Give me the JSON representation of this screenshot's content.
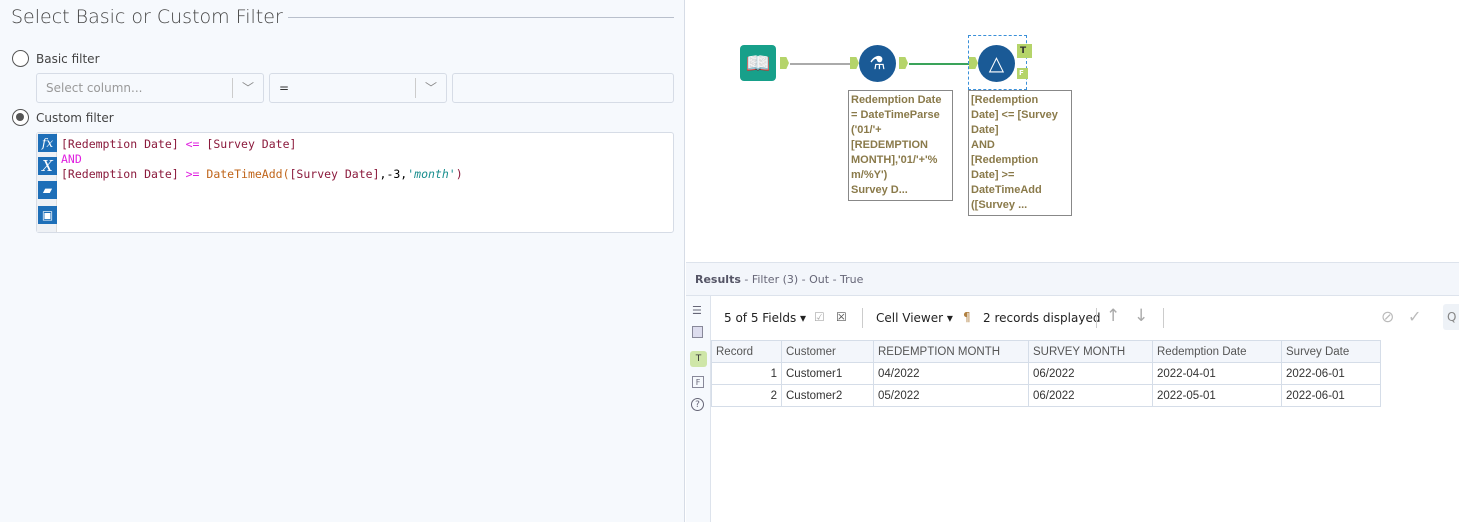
{
  "config": {
    "title": "Select Basic or Custom Filter",
    "basic_label": "Basic filter",
    "select_column_placeholder": "Select column...",
    "operator": "=",
    "custom_label": "Custom filter",
    "code": {
      "l1a": "[Redemption Date]",
      "l1b": " <= ",
      "l1c": "[Survey Date]",
      "l2": "AND",
      "l3a": "[Redemption Date]",
      "l3b": " >= ",
      "l3c": "DateTimeAdd(",
      "l3d": "[Survey Date]",
      "l3e": ",-3,",
      "l3f": "'month'",
      "l3g": ")"
    }
  },
  "workflow": {
    "formula_note": [
      "Redemption Date",
      "= DateTimeParse",
      "('01/'+",
      "[REDEMPTION",
      "MONTH],'01/'+'%",
      "m/%Y')",
      "Survey D..."
    ],
    "filter_note": [
      "[Redemption",
      "Date] <= [Survey",
      "Date]",
      "AND",
      "[Redemption",
      "Date] >=",
      "DateTimeAdd",
      "([Survey ..."
    ],
    "true_anchor": "T",
    "false_anchor": "F"
  },
  "results": {
    "label": "Results",
    "subtitle": " - Filter (3) - Out - True",
    "fields": "5 of 5 Fields",
    "viewer": "Cell Viewer",
    "records": "2 records displayed",
    "columns": [
      "Record",
      "Customer",
      "REDEMPTION MONTH",
      "SURVEY MONTH",
      "Redemption Date",
      "Survey Date"
    ],
    "rows": [
      [
        "1",
        "Customer1",
        "04/2022",
        "06/2022",
        "2022-04-01",
        "2022-06-01"
      ],
      [
        "2",
        "Customer2",
        "05/2022",
        "06/2022",
        "2022-05-01",
        "2022-06-01"
      ]
    ]
  },
  "colors": {
    "accent": "#1e6fb8",
    "anchor": "#b5d46a",
    "connection": "#3aa35a"
  }
}
